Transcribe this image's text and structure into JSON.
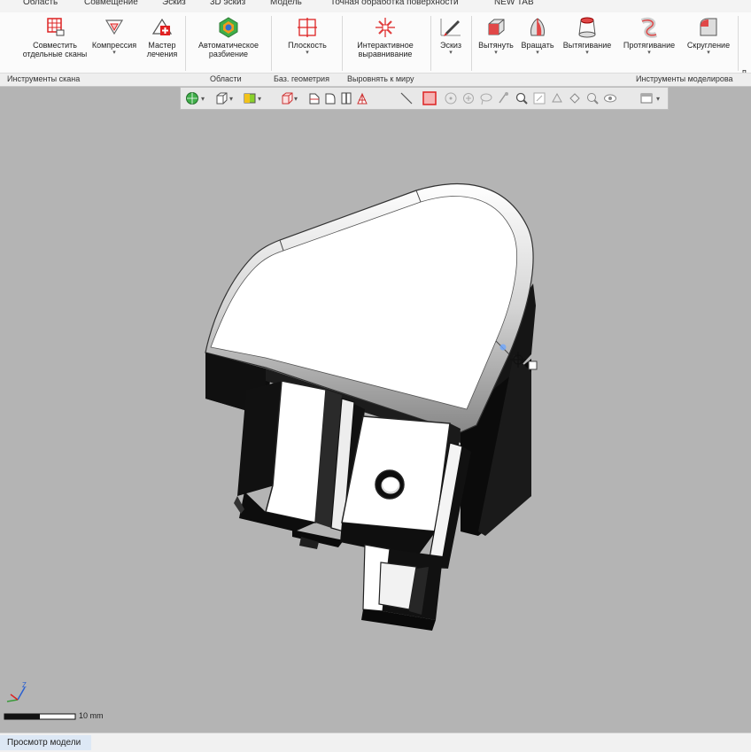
{
  "menu_tabs": [
    "Область",
    "Совмещение",
    "Эскиз",
    "3D эскиз",
    "Модель",
    "Точная обработка поверхности",
    "NEW TAB"
  ],
  "ribbon": {
    "align_scans": {
      "line1": "Совместить",
      "line2": "отдельные сканы"
    },
    "compression": {
      "line1": "Компрессия"
    },
    "healing_wizard": {
      "line1": "Мастер",
      "line2": "лечения"
    },
    "auto_segment": {
      "line1": "Автоматическое",
      "line2": "разбиение"
    },
    "plane": {
      "line1": "Плоскость"
    },
    "interactive_align": {
      "line1": "Интерактивное",
      "line2": "выравнивание"
    },
    "sketch": {
      "line1": "Эскиз"
    },
    "extrude": {
      "line1": "Вытянуть"
    },
    "revolve": {
      "line1": "Вращать"
    },
    "loft": {
      "line1": "Вытягивание"
    },
    "sweep": {
      "line1": "Протягивание"
    },
    "fillet": {
      "line1": "Скругление"
    },
    "cut_label": "п"
  },
  "groups": {
    "scan_tools": "Инструменты скана",
    "regions": "Области",
    "ref_geometry": "Баз. геометрия",
    "align_world": "Выровнять к миру",
    "modeling_tools": "Инструменты моделирова"
  },
  "scale_bar": "10 mm",
  "status_tab": "Просмотр модели",
  "triad": {
    "z": "Z"
  }
}
